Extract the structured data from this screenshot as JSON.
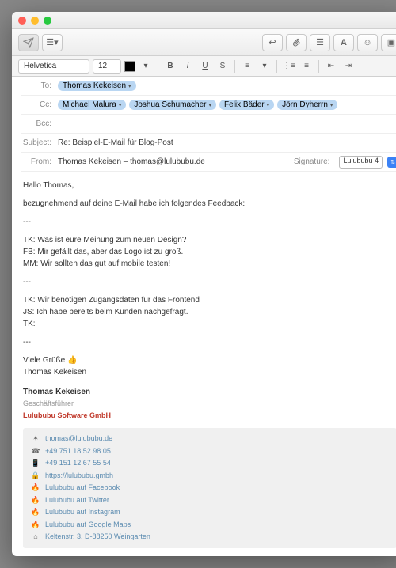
{
  "window": {
    "title": ""
  },
  "format": {
    "font": "Helvetica",
    "size": "12"
  },
  "headers": {
    "to_label": "To:",
    "cc_label": "Cc:",
    "bcc_label": "Bcc:",
    "subject_label": "Subject:",
    "from_label": "From:",
    "sig_label": "Signature:",
    "to": [
      "Thomas Kekeisen"
    ],
    "cc": [
      "Michael Malura",
      "Joshua Schumacher",
      "Felix Bäder",
      "Jörn Dyherrn"
    ],
    "subject": "Re: Beispiel-E-Mail für Blog-Post",
    "from": "Thomas Kekeisen – thomas@lulububu.de",
    "signature": "Lulububu 4"
  },
  "body": {
    "greeting": "Hallo Thomas,",
    "intro": "bezugnehmend auf deine E-Mail habe ich folgendes Feedback:",
    "sep": "---",
    "block1": [
      "TK: Was ist eure Meinung zum neuen Design?",
      "FB: Mir gefällt das, aber das Logo ist zu groß.",
      "MM: Wir sollten das gut auf mobile testen!"
    ],
    "block2": [
      "TK: Wir benötigen Zugangsdaten für das Frontend",
      "JS: Ich habe bereits beim Kunden nachgefragt.",
      "TK:"
    ],
    "closing": "Viele Grüße 👍",
    "sender": "Thomas Kekeisen"
  },
  "signature": {
    "name": "Thomas Kekeisen",
    "title": "Geschäftsführer",
    "company": "Lulububu Software GmbH",
    "contact": [
      {
        "icon": "✶",
        "text": "thomas@lulububu.de"
      },
      {
        "icon": "☎",
        "text": "+49 751 18 52 98 05"
      },
      {
        "icon": "📱",
        "text": "+49 151 12 67 55 54"
      },
      {
        "icon": "🔒",
        "text": "https://lulububu.gmbh"
      },
      {
        "icon": "🔥",
        "text": "Lulububu auf Facebook"
      },
      {
        "icon": "🔥",
        "text": "Lulububu auf Twitter"
      },
      {
        "icon": "🔥",
        "text": "Lulububu auf Instagram"
      },
      {
        "icon": "🔥",
        "text": "Lulububu auf Google Maps"
      },
      {
        "icon": "⌂",
        "text": "Keltenstr. 3, D-88250 Weingarten"
      }
    ]
  }
}
